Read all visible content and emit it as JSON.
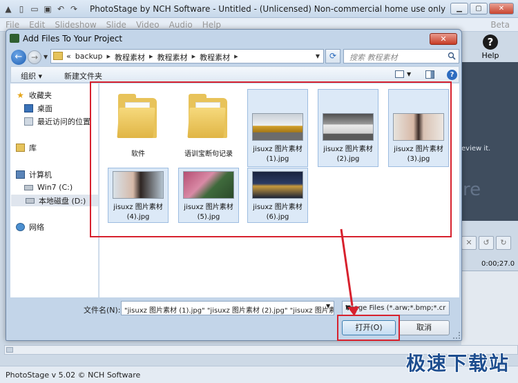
{
  "app": {
    "title": "PhotoStage by NCH Software - Untitled - (Unlicensed) Non-commercial home use only",
    "menus": [
      "File",
      "Edit",
      "Slideshow",
      "Slide",
      "Video",
      "Audio",
      "Help"
    ],
    "beta": "Beta",
    "help_tool": "Help",
    "preview_hint": "eview it.",
    "preview_big": "re",
    "time": "0:00;27.0",
    "status": "PhotoStage v 5.02 © NCH Software",
    "watermark": "极速下载站"
  },
  "dialog": {
    "title": "Add Files To Your Project",
    "address": {
      "prefix": "«",
      "crumbs": [
        "backup",
        "教程素材",
        "教程素材",
        "教程素材"
      ]
    },
    "search_placeholder": "搜索 教程素材",
    "toolbar": {
      "organize": "组织 ▾",
      "new_folder": "新建文件夹"
    },
    "nav": {
      "favorites": "收藏夹",
      "desktop": "桌面",
      "recent": "最近访问的位置",
      "libraries": "库",
      "computer": "计算机",
      "drive_c": "Win7 (C:)",
      "drive_d": "本地磁盘 (D:)",
      "network": "网络"
    },
    "files": [
      {
        "name": "软件",
        "kind": "folder"
      },
      {
        "name": "语训宝断句记录",
        "kind": "folder"
      },
      {
        "name_l1": "jisuxz 图片素材",
        "name_l2": "(1).jpg",
        "kind": "image"
      },
      {
        "name_l1": "jisuxz 图片素材",
        "name_l2": "(2).jpg",
        "kind": "image"
      },
      {
        "name_l1": "jisuxz 图片素材",
        "name_l2": "(3).jpg",
        "kind": "image"
      },
      {
        "name_l1": "jisuxz 图片素材",
        "name_l2": "(4).jpg",
        "kind": "image"
      },
      {
        "name_l1": "jisuxz 图片素材",
        "name_l2": "(5).jpg",
        "kind": "image"
      },
      {
        "name_l1": "jisuxz 图片素材",
        "name_l2": "(6).jpg",
        "kind": "image"
      }
    ],
    "filename_label": "文件名(N):",
    "filename_value": "\"jisuxz 图片素材 (1).jpg\" \"jisuxz 图片素材 (2).jpg\" \"jisuxz 图片素",
    "filetype_value": "Image Files (*.arw;*.bmp;*.cr",
    "open_label": "打开(O)",
    "cancel_label": "取消"
  }
}
